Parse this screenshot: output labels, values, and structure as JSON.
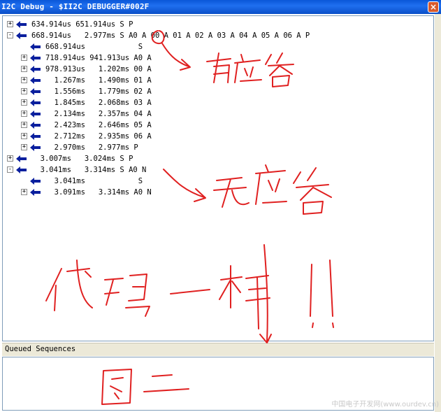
{
  "window": {
    "title": "I2C Debug - $II2C DEBUGGER#002F",
    "close_glyph": "×"
  },
  "tree": {
    "rows": [
      {
        "depth": 0,
        "expander": "+",
        "text": "634.914us 651.914us S P"
      },
      {
        "depth": 0,
        "expander": "-",
        "text": "668.914us   2.977ms S A0 A 00 A 01 A 02 A 03 A 04 A 05 A 06 A P"
      },
      {
        "depth": 1,
        "expander": "",
        "text": "668.914us            S"
      },
      {
        "depth": 1,
        "expander": "+",
        "text": "718.914us 941.913us A0 A"
      },
      {
        "depth": 1,
        "expander": "+",
        "text": "978.913us   1.202ms 00 A"
      },
      {
        "depth": 1,
        "expander": "+",
        "text": "  1.267ms   1.490ms 01 A"
      },
      {
        "depth": 1,
        "expander": "+",
        "text": "  1.556ms   1.779ms 02 A"
      },
      {
        "depth": 1,
        "expander": "+",
        "text": "  1.845ms   2.068ms 03 A"
      },
      {
        "depth": 1,
        "expander": "+",
        "text": "  2.134ms   2.357ms 04 A"
      },
      {
        "depth": 1,
        "expander": "+",
        "text": "  2.423ms   2.646ms 05 A"
      },
      {
        "depth": 1,
        "expander": "+",
        "text": "  2.712ms   2.935ms 06 A"
      },
      {
        "depth": 1,
        "expander": "+",
        "text": "  2.970ms   2.977ms P"
      },
      {
        "depth": 0,
        "expander": "+",
        "text": "  3.007ms   3.024ms S P"
      },
      {
        "depth": 0,
        "expander": "-",
        "text": "  3.041ms   3.314ms S A0 N"
      },
      {
        "depth": 1,
        "expander": "",
        "text": "  3.041ms            S"
      },
      {
        "depth": 1,
        "expander": "+",
        "text": "  3.091ms   3.314ms A0 N"
      }
    ]
  },
  "queued": {
    "label": "Queued Sequences"
  },
  "annotations": {
    "handwriting": [
      "有应答",
      "无应答",
      "代码一样!!",
      "图二"
    ],
    "ink_color": "#e02020"
  },
  "watermark": "中国电子开发网(www.ourdev.cn)",
  "colors": {
    "titlebar": "#0a57d8",
    "arrow": "#0a1f9e",
    "separator": "#ece9d8"
  }
}
